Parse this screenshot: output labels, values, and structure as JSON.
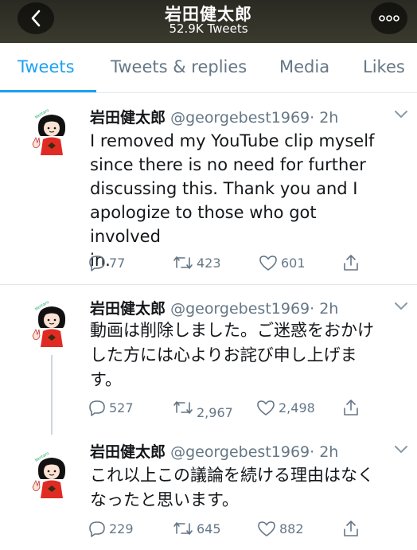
{
  "header": {
    "title": "岩田健太郎",
    "subtitle": "52.9K Tweets",
    "back_icon": "chevron-left-icon",
    "more_icon": "more-horizontal-icon"
  },
  "tabs": [
    {
      "label": "Tweets",
      "active": true
    },
    {
      "label": "Tweets & replies",
      "active": false
    },
    {
      "label": "Media",
      "active": false
    },
    {
      "label": "Likes",
      "active": false
    }
  ],
  "colors": {
    "accent": "#1da1f2",
    "secondary_text": "#657786",
    "avatar_red": "#e02b24"
  },
  "tweets": [
    {
      "name": "岩田健太郎",
      "handle": "@georgebest1969",
      "time": "· 2h",
      "text_lines": [
        "I removed my YouTube clip myself",
        "since there is no need for further",
        "discussing this. Thank you and I",
        "apologize to those who got involved",
        "in."
      ],
      "replies": "77",
      "retweets": "423",
      "likes": "601"
    },
    {
      "name": "岩田健太郎",
      "handle": "@georgebest1969",
      "time": "· 2h",
      "text_lines": [
        "動画は削除しました。ご迷惑をおかけ",
        "した方には心よりお詫び申し上げま",
        "す。"
      ],
      "replies": "527",
      "retweets": "2,967",
      "likes": "2,498"
    },
    {
      "name": "岩田健太郎",
      "handle": "@georgebest1969",
      "time": "· 2h",
      "text_lines": [
        "これ以上この議論を続ける理由はなく",
        "なったと思います。"
      ],
      "replies": "229",
      "retweets": "645",
      "likes": "882"
    }
  ]
}
